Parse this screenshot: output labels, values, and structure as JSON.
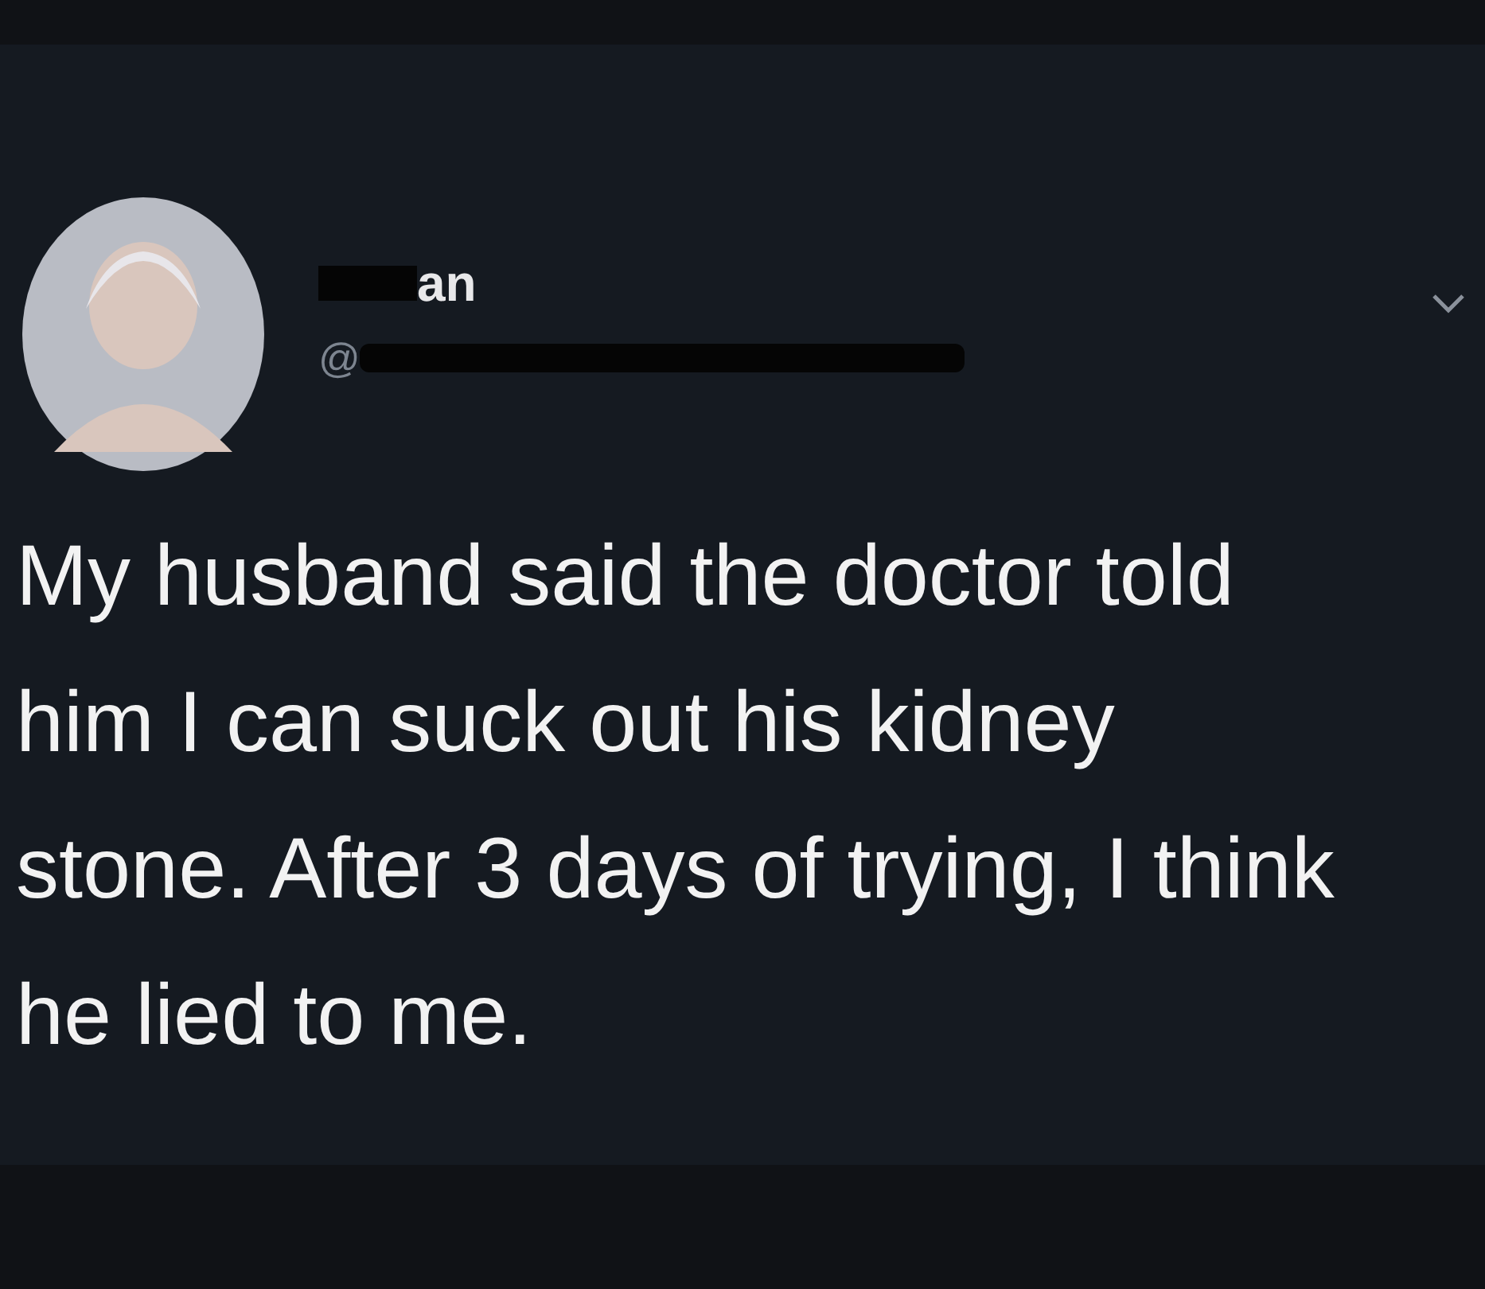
{
  "tweet": {
    "display_name": "an",
    "handle": "@",
    "text": "My husband said the doctor told him I can suck out his kidney stone. After 3 days of trying, I think he lied to me."
  }
}
